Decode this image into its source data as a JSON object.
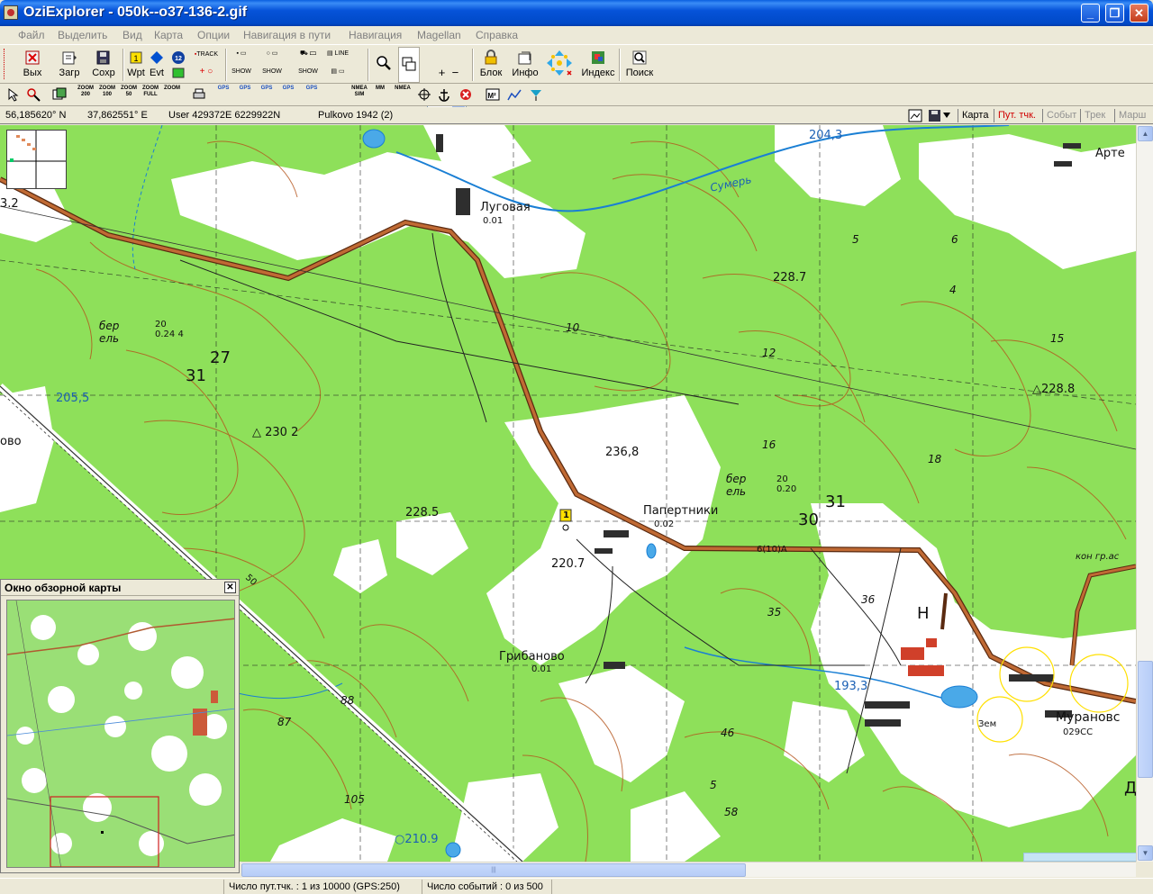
{
  "window": {
    "title": "OziExplorer - 050k--o37-136-2.gif"
  },
  "menu": [
    "Файл",
    "Выделить",
    "Вид",
    "Карта",
    "Опции",
    "Навигация в пути",
    "Навигация",
    "Magellan",
    "Справка"
  ],
  "toolbar": {
    "exit": "Вых",
    "load": "Загр",
    "save": "Сохр",
    "wpt": "Wpt",
    "evt": "Evt",
    "track": "TRACK",
    "show": "SHOW",
    "line": "LINE",
    "zoom_value": "100",
    "block": "Блок",
    "info": "Инфо",
    "index": "Индекс",
    "search": "Поиск"
  },
  "toolbar2": {
    "zoom200": "ZOOM 200",
    "zoom100": "ZOOM 100",
    "zoom50": "ZOOM 50",
    "zoomfull": "ZOOM FULL",
    "zoom": "ZOOM",
    "gps": "GPS",
    "nmea_sim": "NMEA SIM",
    "mm": "MM",
    "nmea": "NMEA"
  },
  "coords": {
    "lat": "56,185620° N",
    "lon": "37,862551° E",
    "grid": "User  429372E  6229922N",
    "datum": "Pulkovo 1942 (2)"
  },
  "object_tabs": [
    "Карта",
    "Пут. тчк.",
    "Событ",
    "Трек",
    "Марш"
  ],
  "map_labels": {
    "luговая": "Луговая",
    "lugovaya_val": "0.01",
    "summer": "Сумерь",
    "h2043": "204,3",
    "arte": "Арте",
    "l32": "3.2",
    "h2287": "228.7",
    "h2055": "205,5",
    "n31a": "31",
    "n27": "27",
    "h2302": "230 2",
    "bero1": "бер",
    "elo1": "ель",
    "frac1": "20",
    "frac1b": "0.24",
    "frac1c": "4",
    "h2368": "236,8",
    "bero2": "бер",
    "elo2": "ель",
    "frac2": "20",
    "frac2b": "0.20",
    "h2285": "228.5",
    "papertniki": "Папертники",
    "pap_val": "0.02",
    "n30": "30",
    "n31b": "31",
    "h2207": "220.7",
    "route": "6(10)А",
    "n36": "36",
    "n35": "35",
    "gribanovo": "Грибаново",
    "grib_val": "0.01",
    "h1933": "193,3",
    "muranovo": "Мурановс",
    "mur_val": "029СС",
    "zem": "Зем",
    "h2288": "228.8",
    "ovo": "ово",
    "n10": "10",
    "n12": "12",
    "n16": "16",
    "n18": "18",
    "n5": "5",
    "n6": "6",
    "n4": "4",
    "n15": "15",
    "n88": "88",
    "n87": "87",
    "n105": "105",
    "n46": "46",
    "n58": "58",
    "n5b": "5",
    "h2109": "210.9",
    "n50": "50",
    "nH": "Н",
    "kong": "кон гр.ас",
    "d": "Д",
    "wpt1": "1"
  },
  "overview": {
    "title": "Окно обзорной карты"
  },
  "status": {
    "waypoints": "Число пут.тчк. : 1 из 10000  (GPS:250)",
    "events": "Число событий : 0 из 500"
  },
  "colors": {
    "map_green": "#8ee05a",
    "road": "#b8562a",
    "contour": "#b4541c",
    "water": "#1a7fd4",
    "title_blue": "#0653d9"
  }
}
